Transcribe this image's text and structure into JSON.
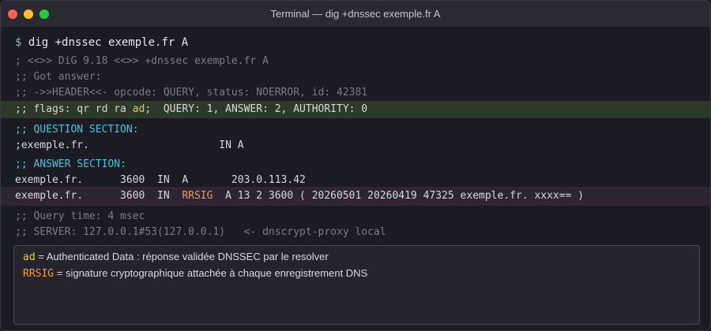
{
  "window": {
    "title": "Terminal — dig +dnssec exemple.fr A"
  },
  "terminal": {
    "prompt_symbol": "$",
    "command": "dig +dnssec exemple.fr A",
    "header_lines": [
      "; <<>> DiG 9.18 <<>> +dnssec exemple.fr A",
      ";; Got answer:",
      ";; ->>HEADER<<- opcode: QUERY, status: NOERROR, id: 42381"
    ],
    "flags_line": {
      "prefix": ";; flags: qr rd ra ",
      "ad_flag": "ad",
      "suffix": ";  QUERY: 1, ANSWER: 2, AUTHORITY: 0"
    },
    "question_section": {
      "heading": ";; QUESTION SECTION:",
      "row": ";exemple.fr.                     IN A"
    },
    "answer_section": {
      "heading": ";; ANSWER SECTION:",
      "row1": "exemple.fr.      3600  IN  A       203.0.113.42",
      "row2": {
        "prefix": "exemple.fr.      3600  IN  ",
        "rrsig": "RRSIG",
        "suffix": "  A 13 2 3600 ( 20260501 20260419 47325 exemple.fr. xxxx== )"
      }
    },
    "footer_lines": [
      ";; Query time: 4 msec",
      ";; SERVER: 127.0.0.1#53(127.0.0.1)   <- dnscrypt-proxy local"
    ]
  },
  "legend": {
    "ad": {
      "term": "ad",
      "text": " = Authenticated Data : réponse validée DNSSEC par le resolver"
    },
    "rrsig": {
      "term": "RRSIG",
      "text": " = signature cryptographique attachée à chaque enregistrement DNS"
    }
  },
  "colors": {
    "prompt": "#5fd787",
    "section_heading": "#4fc3d9",
    "ad_highlight": "#f2c94c",
    "rrsig_highlight": "#f2994a",
    "flags_row_bg": "#2c3a27",
    "rrsig_row_bg": "#2d2535"
  }
}
